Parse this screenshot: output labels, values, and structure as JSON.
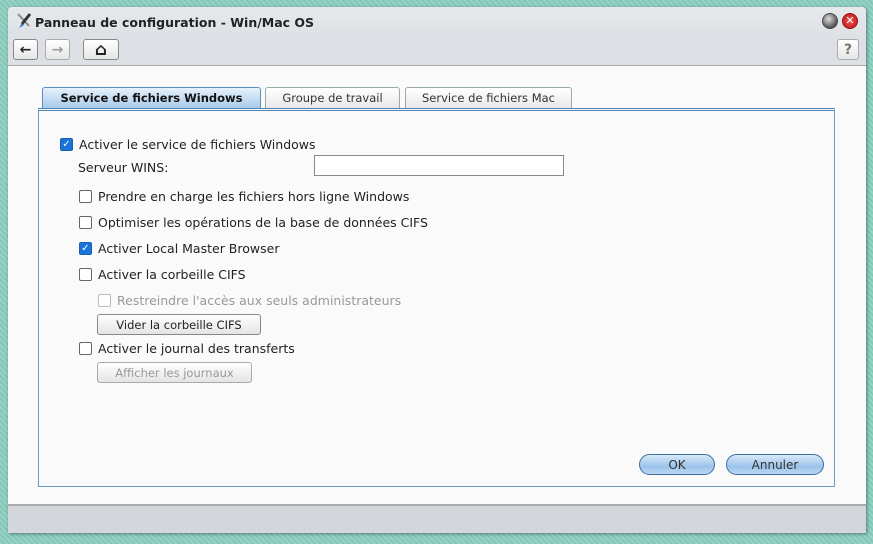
{
  "window": {
    "title": "Panneau de configuration - Win/Mac OS"
  },
  "toolbar": {
    "back": "←",
    "forward": "→",
    "home": "⌂",
    "help": "?"
  },
  "tabs": [
    {
      "label": "Service de fichiers Windows",
      "active": true
    },
    {
      "label": "Groupe de travail"
    },
    {
      "label": "Service de fichiers Mac"
    }
  ],
  "form": {
    "enable_windows": {
      "label": "Activer le service de fichiers Windows",
      "checked": true
    },
    "wins_label": "Serveur WINS:",
    "wins_value": "",
    "offline": {
      "label": "Prendre en charge les fichiers hors ligne Windows",
      "checked": false
    },
    "optimize": {
      "label": "Optimiser les opérations de la base de données CIFS",
      "checked": false
    },
    "master_browser": {
      "label": "Activer Local Master Browser",
      "checked": true
    },
    "recycle": {
      "label": "Activer la corbeille CIFS",
      "checked": false
    },
    "restrict": {
      "label": "Restreindre l'accès aux seuls administrateurs",
      "checked": false
    },
    "empty_recycle": "Vider la corbeille CIFS",
    "transfer_log": {
      "label": "Activer le journal des transferts",
      "checked": false
    },
    "show_logs": "Afficher les journaux"
  },
  "actions": {
    "ok": "OK",
    "cancel": "Annuler"
  }
}
